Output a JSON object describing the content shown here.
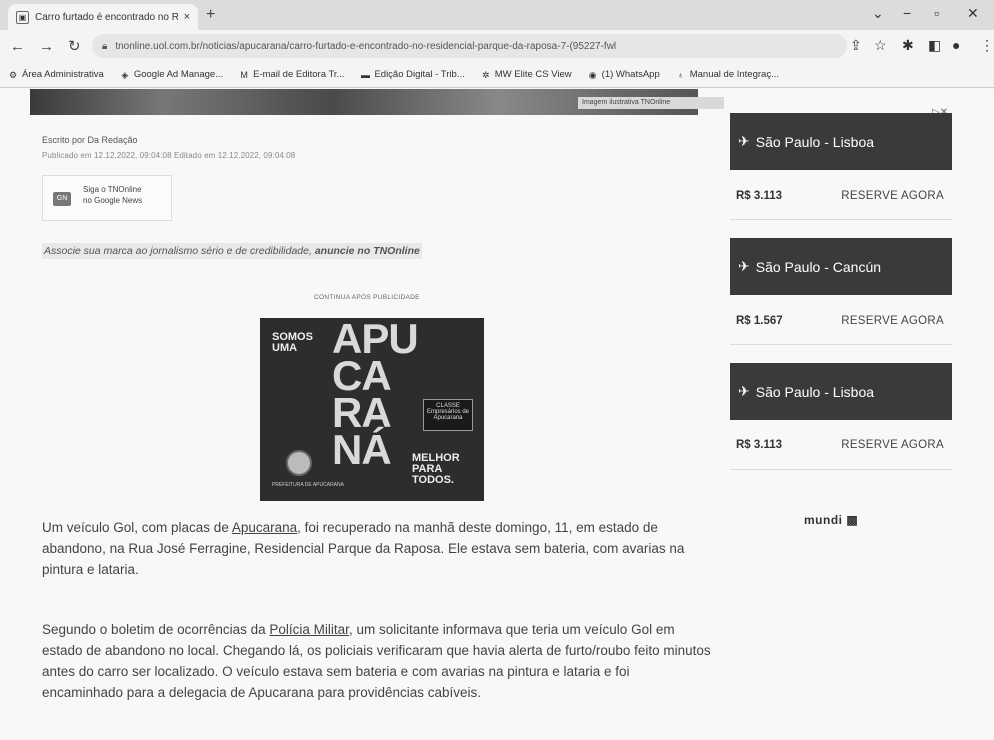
{
  "browser": {
    "tab_title": "Carro furtado é encontrado no R...",
    "tab_close": "×",
    "new_tab": "+",
    "url": "tnonline.uol.com.br/noticias/apucarana/carro-furtado-e-encontrado-no-residencial-parque-da-raposa-7-(95227-fwl",
    "window_controls": [
      "⌄",
      "−",
      "▫",
      "✕"
    ],
    "bookmarks": [
      {
        "label": "Área Administrativa",
        "icon": "gear-icon"
      },
      {
        "label": "Google Ad Manage...",
        "icon": "ad-manager-icon"
      },
      {
        "label": "E-mail de Editora Tr...",
        "icon": "gmail-icon"
      },
      {
        "label": "Edição Digital - Trib...",
        "icon": "edition-icon"
      },
      {
        "label": "MW Elite CS View",
        "icon": "mw-icon"
      },
      {
        "label": "(1) WhatsApp",
        "icon": "whatsapp-icon"
      },
      {
        "label": "Manual de Integraç...",
        "icon": "manual-icon"
      }
    ]
  },
  "article": {
    "hero_caption": "Imagem ilustrativa TNOnline",
    "byline": "Escrito por Da Redação",
    "pubinfo": "Publicado em 12.12.2022, 09:04:08    Editado em 12.12.2022, 09:04:08",
    "gnews_line1": "Siga o TNOnline",
    "gnews_line2": "no Google News",
    "promo_text": "Associe sua marca ao jornalismo sério e de credibilidade,",
    "promo_bold": "anuncie no TNOnline",
    "ad_label": "CONTINUA APÓS PUBLICIDADE",
    "ad": {
      "somos": "SOMOS",
      "uma": "UMA",
      "big1": "APU",
      "big2": "CA",
      "big3": "RA",
      "big4": "NÁ",
      "badge": "CLASSE Empresários de Apucarana",
      "melhor": "MELHOR",
      "para": "PARA",
      "todos": "TODOS.",
      "prefeitura": "PREFEITURA DE APUCARANA"
    },
    "p1_a": "Um veículo Gol, com placas de ",
    "p1_link": "Apucarana",
    "p1_b": ", foi recuperado na manhã deste domingo, 11, em estado de abandono, na Rua José Ferragine, Residencial Parque da Raposa. Ele estava sem bateria, com avarias na pintura e lataria.",
    "p2_a": "Segundo o boletim de ocorrências da ",
    "p2_link": "Polícia Militar",
    "p2_b": ", um solicitante informava que teria um veículo Gol em estado de abandono no local. Chegando lá, os policiais verificaram que havia alerta de furto/roubo feito minutos antes do carro ser localizado. O veículo estava sem bateria e com avarias na pintura e lataria e foi encaminhado para a delegacia de Apucarana para providências cabíveis."
  },
  "sidebar": {
    "adchoices": "▷✕",
    "flights": [
      {
        "route": "São Paulo - Lisboa",
        "price": "R$ 3.113",
        "cta": "RESERVE AGORA"
      },
      {
        "route": "São Paulo - Cancún",
        "price": "R$ 1.567",
        "cta": "RESERVE AGORA"
      },
      {
        "route": "São Paulo - Lisboa",
        "price": "R$ 3.113",
        "cta": "RESERVE AGORA"
      }
    ],
    "brand": "mundi"
  }
}
